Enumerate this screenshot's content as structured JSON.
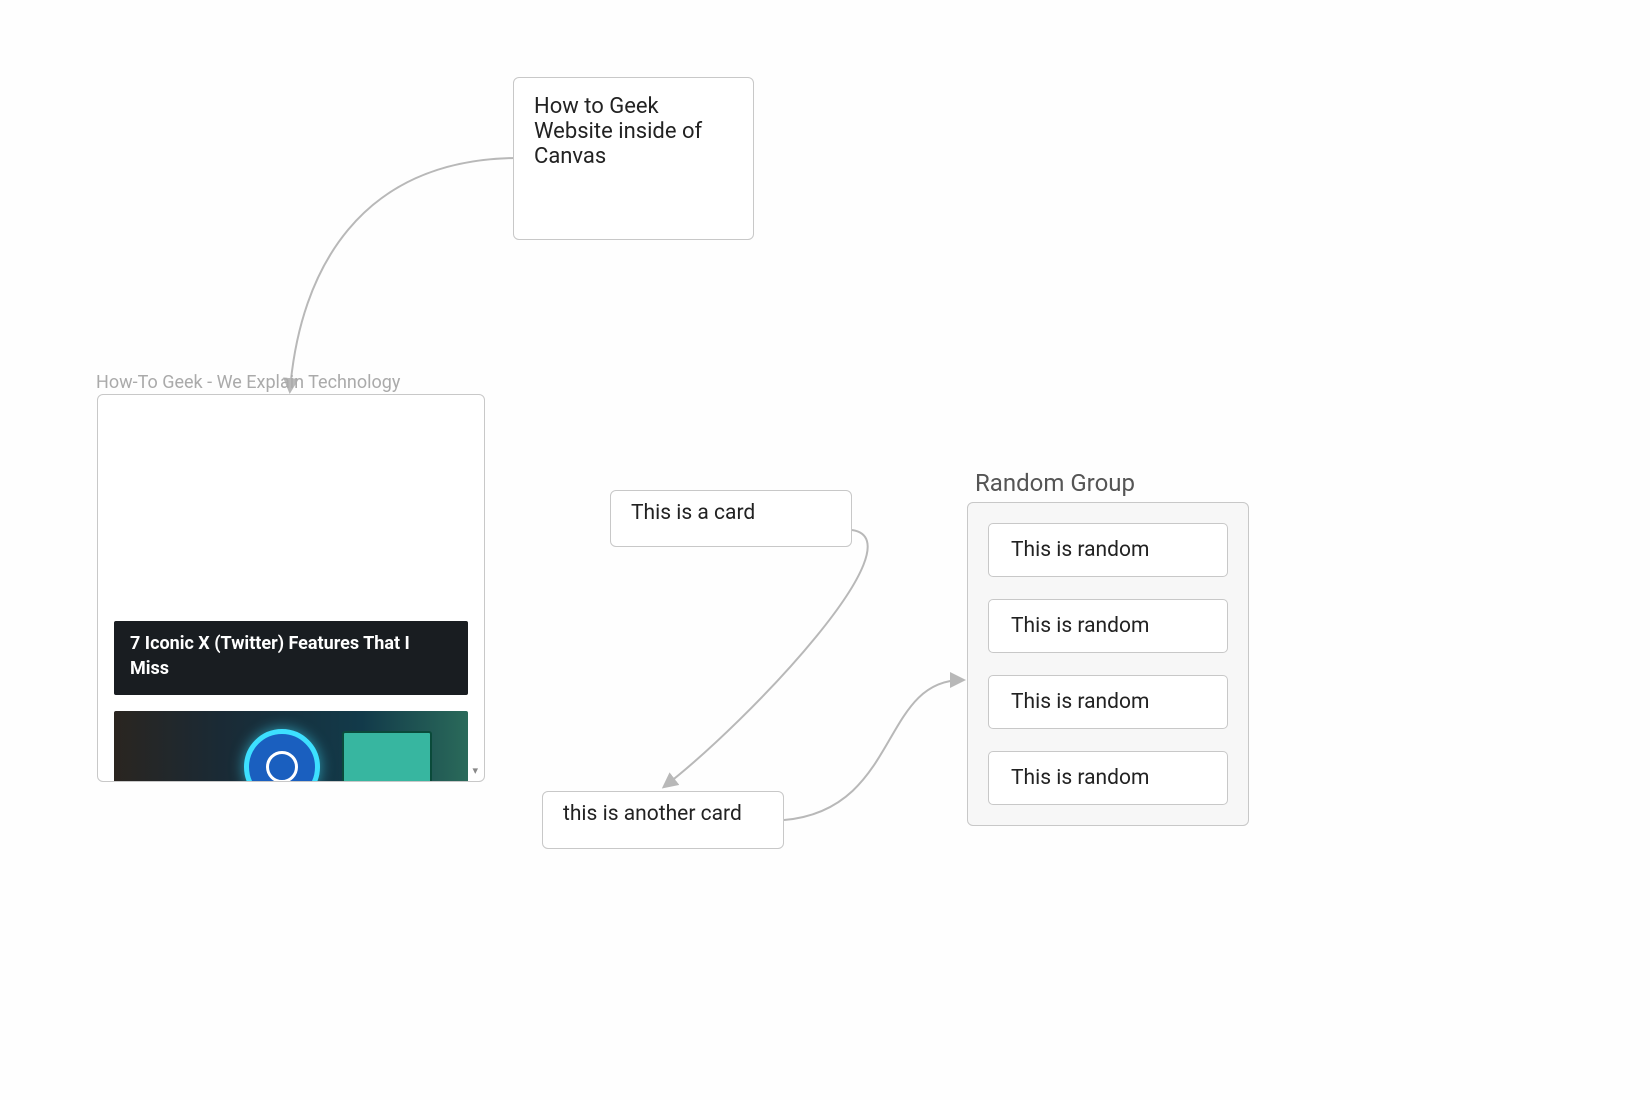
{
  "nodes": {
    "note1": {
      "text": "How to Geek Website inside of Canvas"
    },
    "iframe": {
      "label": "How-To Geek - We Explain Technology",
      "article_title": "7 Iconic X (Twitter) Features That I Miss",
      "expander_glyph": "▾"
    },
    "card1": {
      "text": "This is a card"
    },
    "card2": {
      "text": "this is another card"
    },
    "group": {
      "label": "Random Group",
      "items": [
        {
          "text": "This is random"
        },
        {
          "text": "This is random"
        },
        {
          "text": "This is random"
        },
        {
          "text": "This is random"
        }
      ]
    }
  }
}
